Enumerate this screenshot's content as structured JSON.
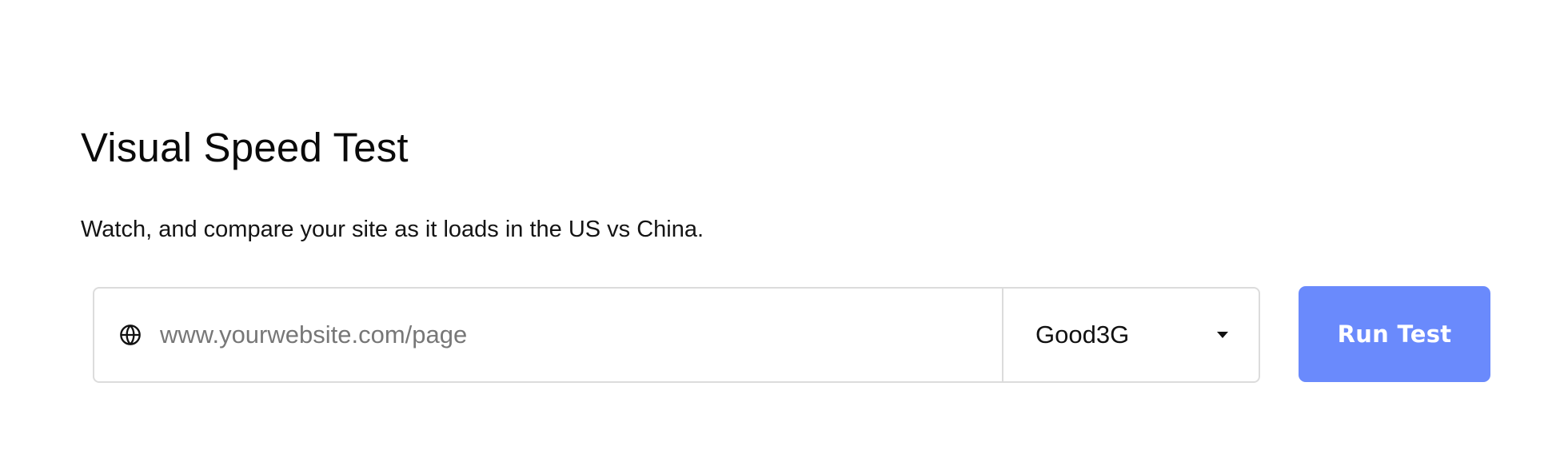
{
  "header": {
    "title": "Visual Speed Test",
    "subtitle": "Watch, and compare your site as it loads in the US vs China."
  },
  "form": {
    "url_input": {
      "value": "",
      "placeholder": "www.yourwebsite.com/page",
      "icon": "globe-icon"
    },
    "network_select": {
      "selected": "Good3G",
      "icon": "caret-down-icon"
    },
    "run_button": {
      "label": "Run Test"
    }
  },
  "colors": {
    "accent": "#6a8afc",
    "border": "#dcdcdc",
    "text": "#111111",
    "placeholder": "#777777"
  }
}
